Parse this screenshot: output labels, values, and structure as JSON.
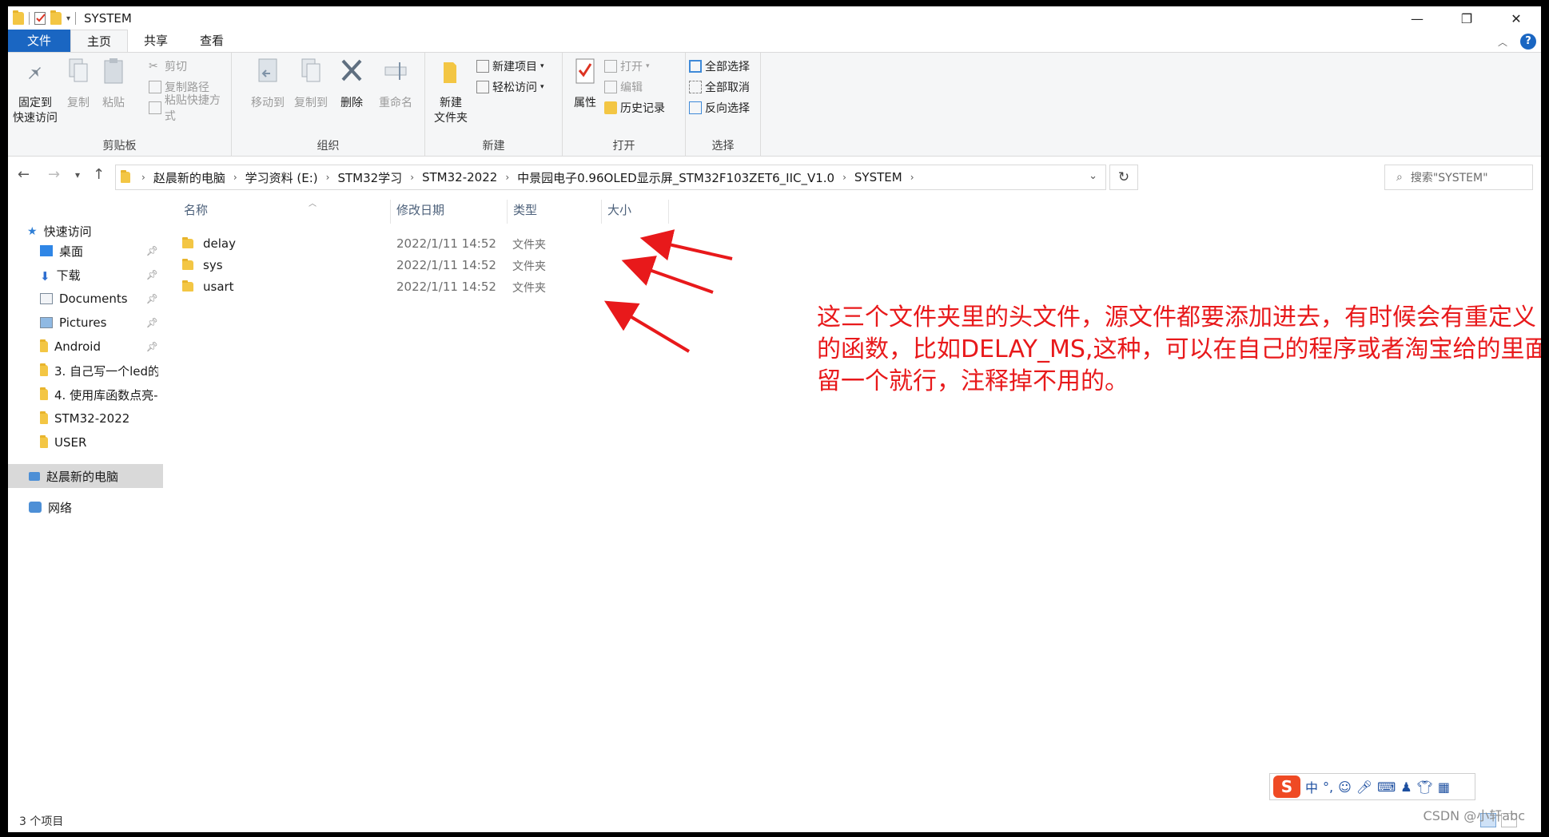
{
  "window": {
    "title": "SYSTEM",
    "controls": [
      "—",
      "❐",
      "✕"
    ]
  },
  "tabs": [
    {
      "label": "文件"
    },
    {
      "label": "主页"
    },
    {
      "label": "共享"
    },
    {
      "label": "查看"
    }
  ],
  "ribbon": {
    "clipboard": {
      "label": "剪贴板",
      "pin": "固定到\n快速访问",
      "pin_line1": "固定到",
      "pin_line2": "快速访问",
      "copy": "复制",
      "paste": "粘贴",
      "cut": "剪切",
      "copy_path": "复制路径",
      "paste_shortcut": "粘贴快捷方式"
    },
    "organize": {
      "label": "组织",
      "move_to": "移动到",
      "copy_to": "复制到",
      "delete": "删除",
      "rename": "重命名"
    },
    "new": {
      "label": "新建",
      "new_folder_line1": "新建",
      "new_folder_line2": "文件夹",
      "new_item": "新建项目",
      "easy_access": "轻松访问"
    },
    "open": {
      "label": "打开",
      "properties": "属性",
      "open": "打开",
      "edit": "编辑",
      "history": "历史记录"
    },
    "select": {
      "label": "选择",
      "select_all": "全部选择",
      "select_none": "全部取消",
      "invert": "反向选择"
    }
  },
  "address": {
    "crumbs": [
      "赵晨新的电脑",
      "学习资料 (E:)",
      "STM32学习",
      "STM32-2022",
      "中景园电子0.96OLED显示屏_STM32F103ZET6_IIC_V1.0",
      "SYSTEM"
    ],
    "search_placeholder": "搜索\"SYSTEM\""
  },
  "nav": {
    "quick_access": "快速访问",
    "items": [
      {
        "label": "桌面",
        "pinned": true
      },
      {
        "label": "下载",
        "pinned": true
      },
      {
        "label": "Documents",
        "pinned": true
      },
      {
        "label": "Pictures",
        "pinned": true
      },
      {
        "label": "Android",
        "pinned": true
      },
      {
        "label": "3. 自己写一个led的",
        "pinned": false
      },
      {
        "label": "4. 使用库函数点亮-",
        "pinned": false
      },
      {
        "label": "STM32-2022",
        "pinned": false
      },
      {
        "label": "USER",
        "pinned": false
      }
    ],
    "this_pc": "赵晨新的电脑",
    "network": "网络"
  },
  "columns": {
    "name": "名称",
    "modified": "修改日期",
    "type": "类型",
    "size": "大小"
  },
  "files": [
    {
      "name": "delay",
      "modified": "2022/1/11 14:52",
      "type": "文件夹"
    },
    {
      "name": "sys",
      "modified": "2022/1/11 14:52",
      "type": "文件夹"
    },
    {
      "name": "usart",
      "modified": "2022/1/11 14:52",
      "type": "文件夹"
    }
  ],
  "annotation": {
    "line1": "这三个文件夹里的头文件，源文件都要添加进去，有时候会有重定义",
    "line2": "的函数，比如DELAY_MS,这种，可以在自己的程序或者淘宝给的里面",
    "line3": "留一个就行，注释掉不用的。",
    "color": "#e8191b"
  },
  "status": {
    "count": "3 个项目"
  },
  "ime": {
    "logo": "S",
    "mode": "中"
  },
  "watermark": "CSDN @小轩abc",
  "colors": {
    "accent": "#1a66c2",
    "folder": "#f3c644"
  }
}
